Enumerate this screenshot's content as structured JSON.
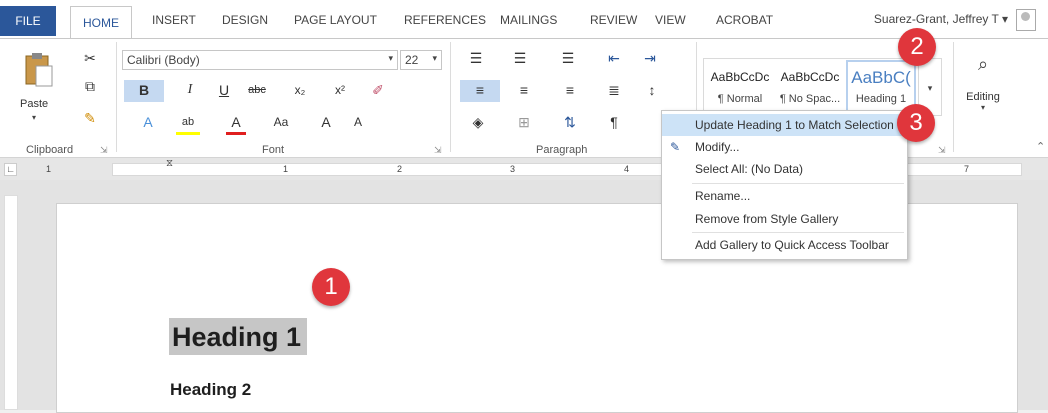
{
  "tabs": [
    {
      "label": "FILE"
    },
    {
      "label": "HOME"
    },
    {
      "label": "INSERT"
    },
    {
      "label": "DESIGN"
    },
    {
      "label": "PAGE LAYOUT"
    },
    {
      "label": "REFERENCES"
    },
    {
      "label": "MAILINGS"
    },
    {
      "label": "REVIEW"
    },
    {
      "label": "VIEW"
    },
    {
      "label": "ACROBAT"
    }
  ],
  "user": {
    "name": "Suarez-Grant, Jeffrey T",
    "caret": "▾"
  },
  "clipboard": {
    "paste_label": "Paste",
    "group_label": "Clipboard"
  },
  "font": {
    "family": "Calibri (Body)",
    "size": "22",
    "group_label": "Font",
    "bold": "B",
    "italic": "I",
    "underline": "U",
    "strike": "abc",
    "subscript": "x₂",
    "superscript": "x²",
    "case": "Aa",
    "grow": "A",
    "shrink": "A"
  },
  "paragraph": {
    "group_label": "Paragraph",
    "pilcrow": "¶"
  },
  "styles": {
    "items": [
      {
        "preview": "AaBbCcDc",
        "name": "¶ Normal"
      },
      {
        "preview": "AaBbCcDc",
        "name": "¶ No Spac..."
      },
      {
        "preview": "AaBbC(",
        "name": "Heading 1"
      }
    ]
  },
  "editing": {
    "label": "Editing"
  },
  "ruler": {
    "marks": [
      "1",
      "1",
      "2",
      "3",
      "4",
      "7"
    ]
  },
  "document": {
    "heading1": "Heading 1",
    "heading2": "Heading 2"
  },
  "context_menu": {
    "items": [
      {
        "label": "Update Heading 1 to Match Selection"
      },
      {
        "label": "Modify..."
      },
      {
        "label": "Select All: (No Data)"
      },
      {
        "label": "Rename..."
      },
      {
        "label": "Remove from Style Gallery"
      },
      {
        "label": "Add Gallery to Quick Access Toolbar"
      }
    ]
  },
  "badges": [
    "1",
    "2",
    "3"
  ],
  "colors": {
    "file_tab": "#2b579a",
    "badge": "#e0363c",
    "menu_highlight": "#cde3f7",
    "heading_highlight": "#c6c6c6"
  }
}
